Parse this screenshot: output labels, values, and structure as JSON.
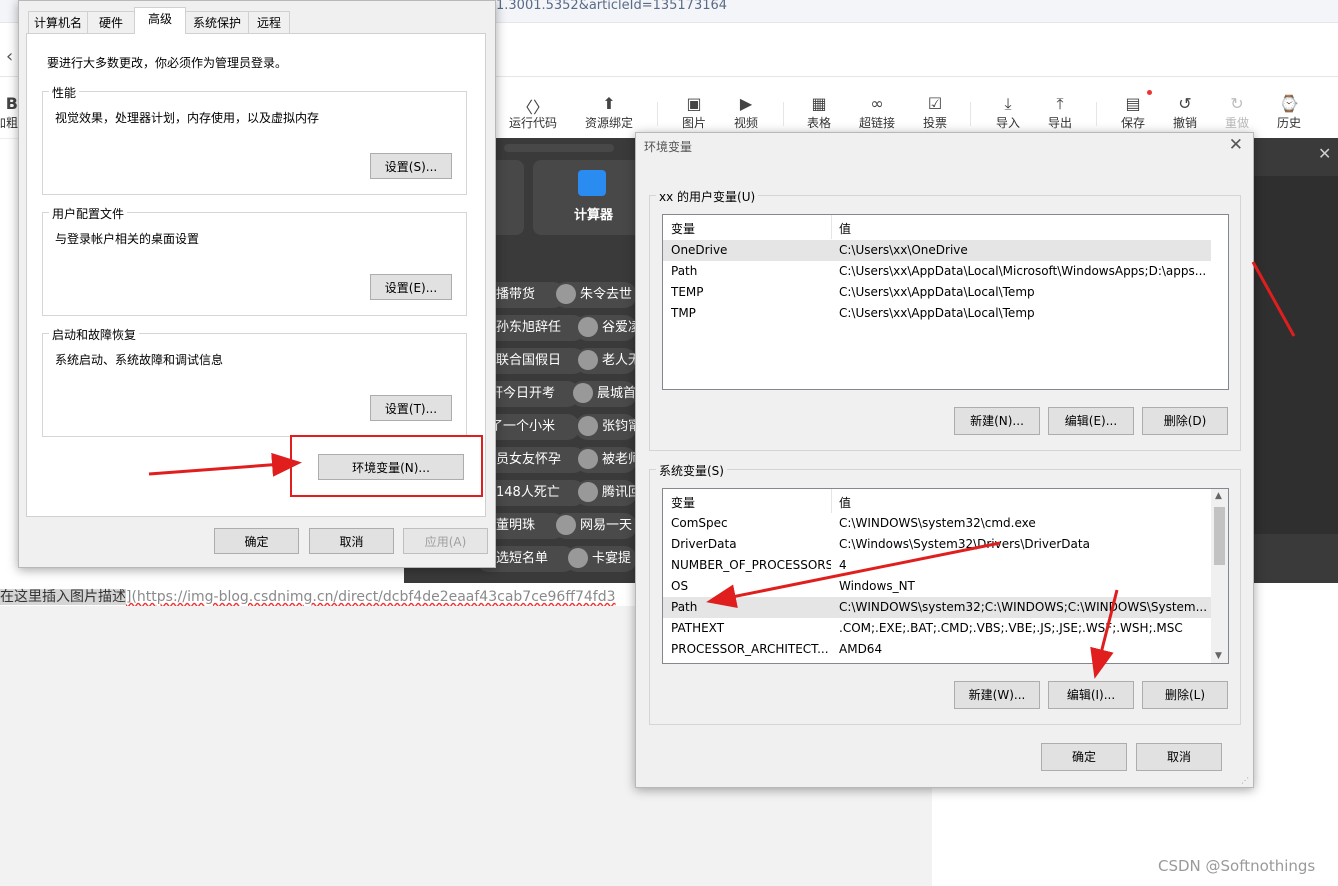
{
  "browser": {
    "url_fragment": "1.3001.5352&articleId=135173164",
    "toolbar": [
      {
        "icon": "code-icon",
        "label": "运行代码"
      },
      {
        "icon": "resource-icon",
        "label": "资源绑定"
      },
      {
        "icon": "image-icon",
        "label": "图片"
      },
      {
        "icon": "video-icon",
        "label": "视频"
      },
      {
        "icon": "table-icon",
        "label": "表格"
      },
      {
        "icon": "link-icon",
        "label": "超链接"
      },
      {
        "icon": "vote-icon",
        "label": "投票"
      },
      {
        "icon": "import-icon",
        "label": "导入"
      },
      {
        "icon": "export-icon",
        "label": "导出"
      },
      {
        "icon": "save-icon",
        "label": "保存"
      },
      {
        "icon": "undo-icon",
        "label": "撤销"
      },
      {
        "icon": "redo-icon",
        "label": "重做"
      },
      {
        "icon": "history-icon",
        "label": "历史"
      }
    ],
    "left_toolbar_partial": "加粗",
    "calculator_label": "计算器",
    "news_left": [
      "播带货",
      "孙东旭辞任",
      "联合国假日",
      "轩今日开考",
      "了一个小米",
      "员女友怀孕",
      "148人死亡",
      "董明珠",
      "选短名单"
    ],
    "news_right": [
      "朱令去世",
      "谷爱凌",
      "老人无",
      "晨城首",
      "张钧甯",
      "被老师",
      "腾讯回",
      "网易一天",
      "卡宴提"
    ],
    "insert_text": "在这里插入图片描述",
    "insert_url": "](https://img-blog.csdnimg.cn/direct/dcbf4de2eaaf43cab7ce96ff74fd3",
    "watermark": "CSDN @Softnothings"
  },
  "system_properties": {
    "tabs": [
      "计算机名",
      "硬件",
      "高级",
      "系统保护",
      "远程"
    ],
    "active_tab": "高级",
    "admin_note": "要进行大多数更改，你必须作为管理员登录。",
    "groups": [
      {
        "title": "性能",
        "desc": "视觉效果，处理器计划，内存使用，以及虚拟内存",
        "button": "设置(S)..."
      },
      {
        "title": "用户配置文件",
        "desc": "与登录帐户相关的桌面设置",
        "button": "设置(E)..."
      },
      {
        "title": "启动和故障恢复",
        "desc": "系统启动、系统故障和调试信息",
        "button": "设置(T)..."
      }
    ],
    "env_button": "环境变量(N)...",
    "ok": "确定",
    "cancel": "取消",
    "apply": "应用(A)"
  },
  "env_dialog": {
    "title": "环境变量",
    "user_group_title": "xx 的用户变量(U)",
    "col_var": "变量",
    "col_val": "值",
    "user_vars": [
      {
        "name": "OneDrive",
        "value": "C:\\Users\\xx\\OneDrive"
      },
      {
        "name": "Path",
        "value": "C:\\Users\\xx\\AppData\\Local\\Microsoft\\WindowsApps;D:\\apps..."
      },
      {
        "name": "TEMP",
        "value": "C:\\Users\\xx\\AppData\\Local\\Temp"
      },
      {
        "name": "TMP",
        "value": "C:\\Users\\xx\\AppData\\Local\\Temp"
      }
    ],
    "user_buttons": {
      "new": "新建(N)...",
      "edit": "编辑(E)...",
      "delete": "删除(D)"
    },
    "system_group_title": "系统变量(S)",
    "system_vars": [
      {
        "name": "ComSpec",
        "value": "C:\\WINDOWS\\system32\\cmd.exe"
      },
      {
        "name": "DriverData",
        "value": "C:\\Windows\\System32\\Drivers\\DriverData"
      },
      {
        "name": "NUMBER_OF_PROCESSORS",
        "value": "4"
      },
      {
        "name": "OS",
        "value": "Windows_NT"
      },
      {
        "name": "Path",
        "value": "C:\\WINDOWS\\system32;C:\\WINDOWS;C:\\WINDOWS\\System..."
      },
      {
        "name": "PATHEXT",
        "value": ".COM;.EXE;.BAT;.CMD;.VBS;.VBE;.JS;.JSE;.WSF;.WSH;.MSC"
      },
      {
        "name": "PROCESSOR_ARCHITECT...",
        "value": "AMD64"
      }
    ],
    "system_buttons": {
      "new": "新建(W)...",
      "edit": "编辑(I)...",
      "delete": "删除(L)"
    },
    "ok": "确定",
    "cancel": "取消"
  },
  "colors": {
    "annotation_red": "#e01e1e",
    "selection_gray": "#e5e5e5"
  }
}
